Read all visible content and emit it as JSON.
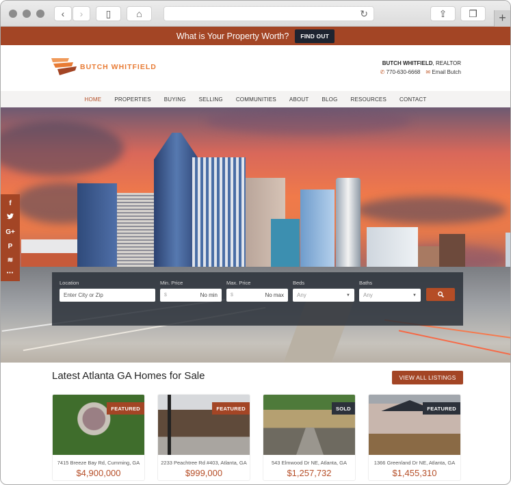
{
  "browser": {
    "back_icon": "‹",
    "forward_icon": "›",
    "sidebar_icon": "▯",
    "home_icon": "⌂",
    "reload_icon": "↻",
    "share_icon": "⇪",
    "tabs_icon": "❐",
    "new_tab_icon": "+"
  },
  "promo": {
    "text": "What is Your Property Worth?",
    "button_label": "FIND OUT"
  },
  "header": {
    "logo_text": "BUTCH WHITFIELD",
    "agent_name": "BUTCH WHITFIELD",
    "agent_title": ", REALTOR",
    "phone_icon": "✆",
    "phone": "770-630-6668",
    "email_icon": "✉",
    "email_label": "Email Butch"
  },
  "nav": {
    "items": [
      {
        "label": "HOME",
        "active": true
      },
      {
        "label": "PROPERTIES"
      },
      {
        "label": "BUYING"
      },
      {
        "label": "SELLING"
      },
      {
        "label": "COMMUNITIES"
      },
      {
        "label": "ABOUT"
      },
      {
        "label": "BLOG"
      },
      {
        "label": "RESOURCES"
      },
      {
        "label": "CONTACT"
      }
    ]
  },
  "social": {
    "facebook": "f",
    "twitter": "🐦",
    "google_plus": "G+",
    "pinterest": "P",
    "layers": "≋",
    "more": "•••"
  },
  "search": {
    "location_label": "Location",
    "location_placeholder": "Enter City or Zip",
    "min_price_label": "Min. Price",
    "min_price_prefix": "$",
    "min_price_value": "No min",
    "max_price_label": "Max. Price",
    "max_price_prefix": "$",
    "max_price_value": "No max",
    "beds_label": "Beds",
    "beds_value": "Any",
    "baths_label": "Baths",
    "baths_value": "Any"
  },
  "listings": {
    "title": "Latest Atlanta GA Homes for Sale",
    "view_all_label": "VIEW ALL LISTINGS",
    "items": [
      {
        "badge": "FEATURED",
        "address": "7415 Breeze Bay Rd, Cumming, GA",
        "price": "$4,900,000"
      },
      {
        "badge": "FEATURED",
        "address": "2233 Peachtree Rd #403, Atlanta, GA",
        "price": "$999,000"
      },
      {
        "badge": "SOLD",
        "address": "543 Elmwood Dr NE, Atlanta, GA",
        "price": "$1,257,732"
      },
      {
        "badge": "FEATURED",
        "address": "1366 Greenland Dr NE, Atlanta, GA",
        "price": "$1,455,310"
      }
    ]
  },
  "colors": {
    "brand": "#a34525",
    "accent_text": "#b54d26",
    "logo_orange": "#e87b34",
    "dark_button": "#1e2430",
    "sold_badge": "#2c313a"
  }
}
